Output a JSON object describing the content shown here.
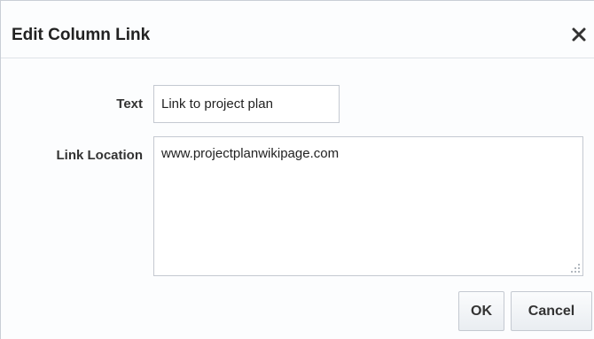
{
  "dialog": {
    "title": "Edit Column Link",
    "close_icon": "close-icon"
  },
  "form": {
    "text_label": "Text",
    "text_value": "Link to project plan",
    "link_location_label": "Link Location",
    "link_location_value": "www.projectplanwikipage.com",
    "resize_icon": "resize-grip-icon"
  },
  "buttons": {
    "ok_label": "OK",
    "cancel_label": "Cancel"
  }
}
